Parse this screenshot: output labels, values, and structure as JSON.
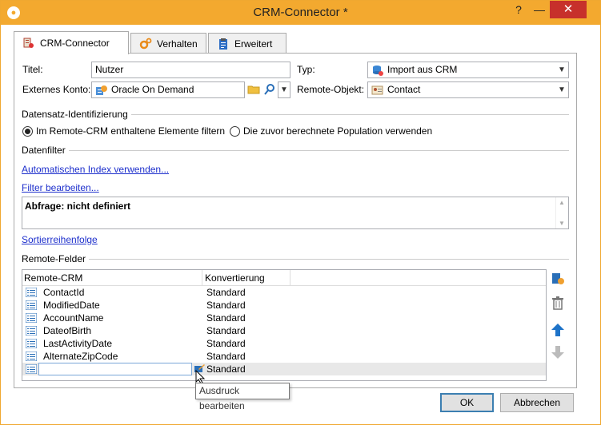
{
  "window": {
    "title": "CRM-Connector *",
    "help": "?",
    "minimize": "—",
    "close": "✕",
    "accent_color": "#f3a92f"
  },
  "tabs": [
    {
      "label": "CRM-Connector",
      "icon": "crm-connector-icon",
      "active": true
    },
    {
      "label": "Verhalten",
      "icon": "gears-icon",
      "active": false
    },
    {
      "label": "Erweitert",
      "icon": "clipboard-icon",
      "active": false
    }
  ],
  "form": {
    "title_label": "Titel:",
    "title_value": "Nutzer",
    "type_label": "Typ:",
    "type_value": "Import aus CRM",
    "account_label": "Externes Konto:",
    "account_value": "Oracle On Demand",
    "remote_object_label": "Remote-Objekt:",
    "remote_object_value": "Contact"
  },
  "identification": {
    "section_title": "Datensatz-Identifizierung",
    "option1": "Im Remote-CRM enthaltene Elemente filtern",
    "option2": "Die zuvor berechnete Population verwenden",
    "selected": 1
  },
  "datafilter": {
    "section_title": "Datenfilter",
    "auto_index_link": "Automatischen Index verwenden...",
    "edit_filter_link": "Filter bearbeiten...",
    "query_text": "Abfrage: nicht definiert",
    "sort_link": "Sortierreihenfolge"
  },
  "remote_fields": {
    "section_title": "Remote-Felder",
    "columns": [
      "Remote-CRM",
      "Konvertierung"
    ],
    "rows": [
      {
        "name": "ContactId",
        "conversion": "Standard"
      },
      {
        "name": "ModifiedDate",
        "conversion": "Standard"
      },
      {
        "name": "AccountName",
        "conversion": "Standard"
      },
      {
        "name": "DateofBirth",
        "conversion": "Standard"
      },
      {
        "name": "LastActivityDate",
        "conversion": "Standard"
      },
      {
        "name": "AlternateZipCode",
        "conversion": "Standard"
      }
    ],
    "edit_row": {
      "name": "",
      "conversion": "Standard"
    },
    "tooltip": "Ausdruck bearbeiten"
  },
  "buttons": {
    "ok": "OK",
    "cancel": "Abbrechen"
  }
}
